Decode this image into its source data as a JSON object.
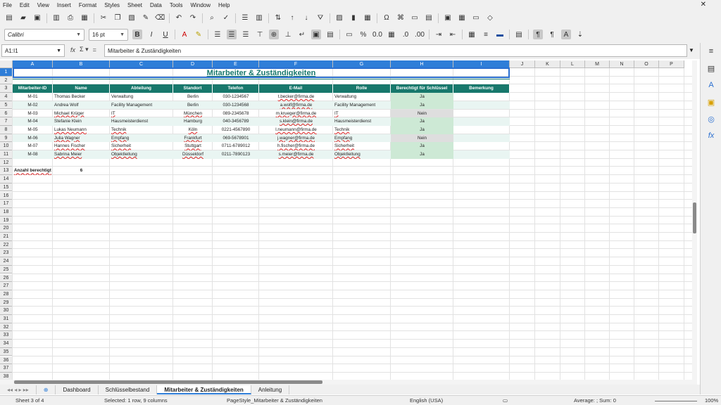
{
  "menu": [
    "File",
    "Edit",
    "View",
    "Insert",
    "Format",
    "Styles",
    "Sheet",
    "Data",
    "Tools",
    "Window",
    "Help"
  ],
  "font": {
    "name": "Calibri",
    "size": "16 pt"
  },
  "namebox": "A1:I1",
  "formula": "Mitarbeiter & Zuständigkeiten",
  "columns": [
    "A",
    "B",
    "C",
    "D",
    "E",
    "F",
    "G",
    "H",
    "I",
    "J",
    "K",
    "L",
    "M",
    "N",
    "O",
    "P"
  ],
  "title": "Mitarbeiter & Zuständigkeiten",
  "headers": [
    "Mitarbeiter-ID",
    "Name",
    "Abteilung",
    "Standort",
    "Telefon",
    "E-Mail",
    "Rolle",
    "Berechtigt für Schlüssel",
    "Bemerkung"
  ],
  "rows": [
    [
      "M-01",
      "Thomas Becker",
      "Verwaltung",
      "Berlin",
      "030-1234567",
      "t.becker@firma.de",
      "Verwaltung",
      "Ja",
      ""
    ],
    [
      "M-02",
      "Andrea Wolf",
      "Facility Management",
      "Berlin",
      "030-1234568",
      "a.wolf@firma.de",
      "Facility Management",
      "Ja",
      ""
    ],
    [
      "M-03",
      "Michael Krüger",
      "IT",
      "München",
      "089-2345678",
      "m.krueger@firma.de",
      "IT",
      "Nein",
      ""
    ],
    [
      "M-04",
      "Stefanie Klein",
      "Hausmeisterdienst",
      "Hamburg",
      "040-3456789",
      "s.klein@firma.de",
      "Hausmeisterdienst",
      "Ja",
      ""
    ],
    [
      "M-05",
      "Lukas Neumann",
      "Technik",
      "Köln",
      "0221-4567890",
      "l.neumann@firma.de",
      "Technik",
      "Ja",
      ""
    ],
    [
      "M-06",
      "Julia Wagner",
      "Empfang",
      "Frankfurt",
      "069-5678901",
      "j.wagner@firma.de",
      "Empfang",
      "Nein",
      ""
    ],
    [
      "M-07",
      "Hannes Fischer",
      "Sicherheit",
      "Stuttgart",
      "0711-6789012",
      "h.fischer@firma.de",
      "Sicherheit",
      "Ja",
      ""
    ],
    [
      "M-08",
      "Sabrina Meier",
      "Objektleitung",
      "Düsseldorf",
      "0211-7890123",
      "s.meier@firma.de",
      "Objektleitung",
      "Ja",
      ""
    ]
  ],
  "summary": {
    "label": "Anzahl berechtigt",
    "value": "6"
  },
  "tabs": [
    "Dashboard",
    "Schlüsselbestand",
    "Mitarbeiter & Zuständigkeiten",
    "Anleitung"
  ],
  "active_tab": 2,
  "status": {
    "sheet": "Sheet 3 of 4",
    "selection": "Selected: 1 row, 9 columns",
    "pagestyle": "PageStyle_Mitarbeiter & Zuständigkeiten",
    "language": "English (USA)",
    "stats": "Average: ; Sum: 0",
    "zoom": "100%"
  }
}
